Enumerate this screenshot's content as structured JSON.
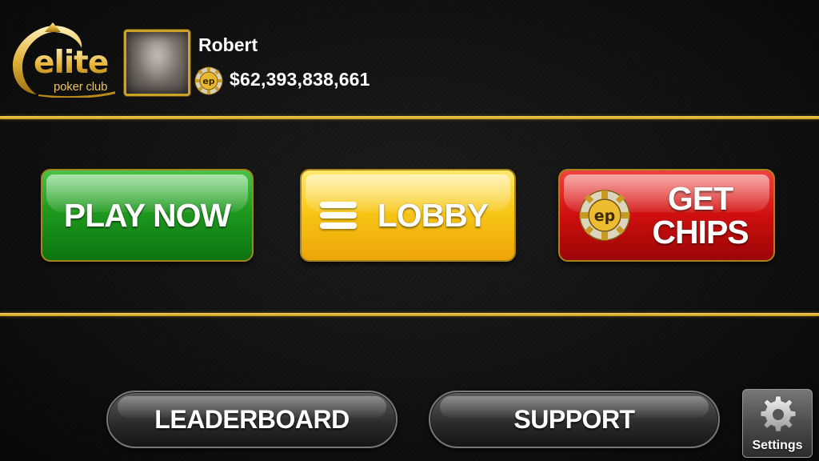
{
  "brand": {
    "name": "elite",
    "tagline": "poker club"
  },
  "player": {
    "name": "Robert",
    "balance": "$62,393,838,661"
  },
  "chip_logo_text": "ep",
  "main_buttons": {
    "play_now": "PLAY NOW",
    "lobby": "LOBBY",
    "get_chips_line1": "GET",
    "get_chips_line2": "CHIPS"
  },
  "bottom_buttons": {
    "leaderboard": "LEADERBOARD",
    "support": "SUPPORT",
    "settings": "Settings"
  },
  "colors": {
    "gold_accent": "#c9a227",
    "play_green": "#1f9a1f",
    "lobby_yellow": "#f7c514",
    "chips_red": "#cf0f0f"
  },
  "icons": {
    "menu": "hamburger-icon",
    "chip": "poker-chip-icon",
    "settings": "gear-icon"
  }
}
